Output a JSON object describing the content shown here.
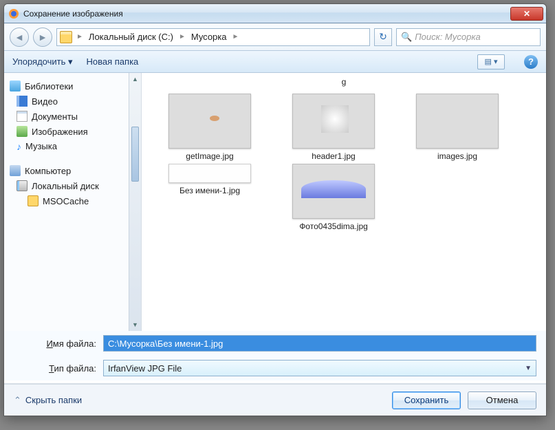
{
  "title": "Сохранение изображения",
  "close_glyph": "✕",
  "nav": {
    "back_glyph": "◄",
    "fwd_glyph": "►",
    "refresh_glyph": "↻",
    "crumbs": [
      "Локальный диск (C:)",
      "Мусорка"
    ],
    "crumb_sep": "►",
    "search_placeholder": "Поиск: Мусорка"
  },
  "toolbar": {
    "organize": "Упорядочить ▾",
    "new_folder": "Новая папка",
    "view_glyph": "▤ ▾",
    "help_glyph": "?"
  },
  "tree": {
    "libraries": {
      "label": "Библиотеки",
      "video": "Видео",
      "documents": "Документы",
      "images": "Изображения",
      "music": "Музыка"
    },
    "computer": {
      "label": "Компьютер",
      "localdisk": "Локальный диск",
      "msocache": "MSOCache"
    }
  },
  "loose_caption_top": "g",
  "files": [
    {
      "name": "getImage.jpg",
      "thumbclass": "th-sea"
    },
    {
      "name": "header1.jpg",
      "thumbclass": "th-room"
    },
    {
      "name": "images.jpg",
      "thumbclass": "th-pig"
    },
    {
      "name": "Без имени-1.jpg",
      "thumbclass": "short"
    },
    {
      "name": "Фото0435dima.jpg",
      "thumbclass": "th-arena"
    }
  ],
  "fields": {
    "filename_label": "Имя файла:",
    "filename_value": "C:\\Мусорка\\Без имени-1.jpg",
    "filetype_label": "Тип файла:",
    "filetype_value": "IrfanView JPG File"
  },
  "footer": {
    "hide_folders": "Скрыть папки",
    "save": "Сохранить",
    "cancel": "Отмена"
  }
}
